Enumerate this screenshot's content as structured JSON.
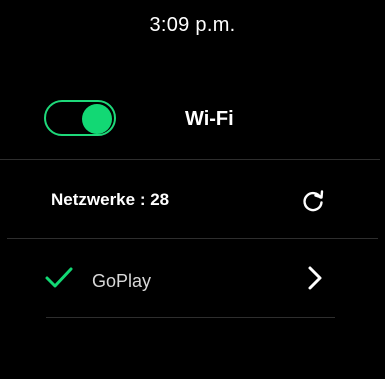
{
  "status_bar": {
    "time": "3:09 p.m."
  },
  "wifi": {
    "label": "Wi-Fi",
    "toggle_state": "on",
    "accent_color": "#12d874"
  },
  "networks": {
    "header": "Netzwerke : 28",
    "refresh_icon": "refresh-icon",
    "items": [
      {
        "name": "GoPlay",
        "connected": true,
        "status_icon": "checkmark-icon",
        "action_icon": "chevron-right-icon"
      }
    ]
  }
}
